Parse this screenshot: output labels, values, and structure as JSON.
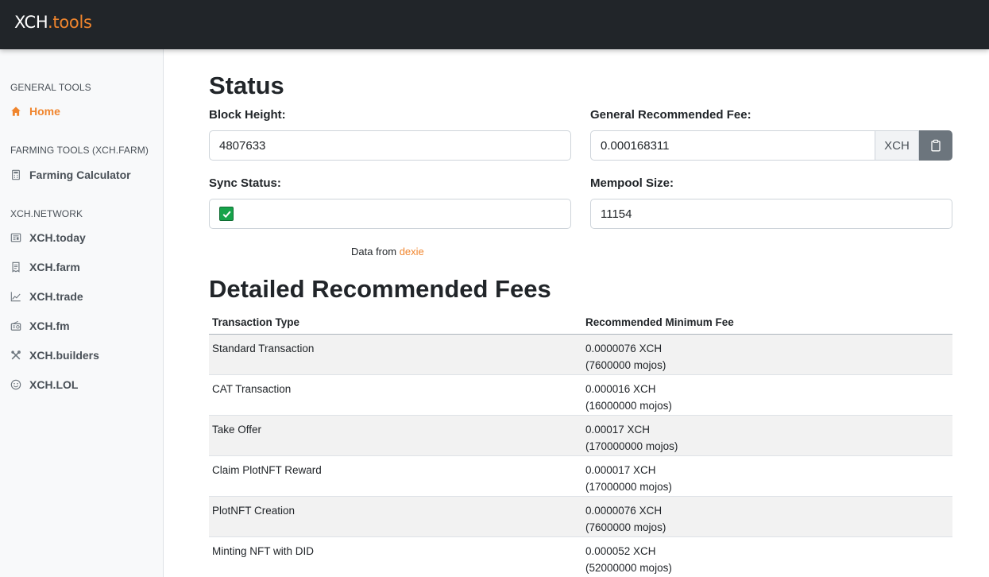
{
  "brand": {
    "part1": "XCH",
    "part2": ".tools"
  },
  "sidebar": {
    "sections": [
      {
        "title": "GENERAL TOOLS",
        "items": [
          {
            "label": "Home",
            "icon": "home-icon",
            "active": true
          }
        ]
      },
      {
        "title": "FARMING TOOLS (XCH.FARM)",
        "items": [
          {
            "label": "Farming Calculator",
            "icon": "calculator-icon"
          }
        ]
      },
      {
        "title": "XCH.NETWORK",
        "items": [
          {
            "label": "XCH.today",
            "icon": "newspaper-icon"
          },
          {
            "label": "XCH.farm",
            "icon": "receipt-icon"
          },
          {
            "label": "XCH.trade",
            "icon": "chart-line-icon"
          },
          {
            "label": "XCH.fm",
            "icon": "radio-icon"
          },
          {
            "label": "XCH.builders",
            "icon": "tools-icon"
          },
          {
            "label": "XCH.LOL",
            "icon": "smile-icon"
          }
        ]
      }
    ]
  },
  "status": {
    "title": "Status",
    "block_height_label": "Block Height:",
    "block_height": "4807633",
    "fee_label": "General Recommended Fee:",
    "fee_value": "0.000168311",
    "fee_unit": "XCH",
    "sync_label": "Sync Status:",
    "sync_ok": true,
    "mempool_label": "Mempool Size:",
    "mempool_size": "11154",
    "data_from": "Data from",
    "data_source": "dexie"
  },
  "fees": {
    "title": "Detailed Recommended Fees",
    "headers": [
      "Transaction Type",
      "Recommended Minimum Fee"
    ],
    "rows": [
      {
        "type": "Standard Transaction",
        "xch": "0.0000076 XCH",
        "mojos": "(7600000 mojos)"
      },
      {
        "type": "CAT Transaction",
        "xch": "0.000016 XCH",
        "mojos": "(16000000 mojos)"
      },
      {
        "type": "Take Offer",
        "xch": "0.00017 XCH",
        "mojos": "(170000000 mojos)"
      },
      {
        "type": "Claim PlotNFT Reward",
        "xch": "0.000017 XCH",
        "mojos": "(17000000 mojos)"
      },
      {
        "type": "PlotNFT Creation",
        "xch": "0.0000076 XCH",
        "mojos": "(7600000 mojos)"
      },
      {
        "type": "Minting NFT with DID",
        "xch": "0.000052 XCH",
        "mojos": "(52000000 mojos)"
      }
    ]
  },
  "colors": {
    "accent": "#f0852d",
    "topbar": "#212529",
    "sidebar_bg": "#f8f9fa",
    "copy_button": "#6c757d",
    "sync_ok": "#16a34a"
  }
}
